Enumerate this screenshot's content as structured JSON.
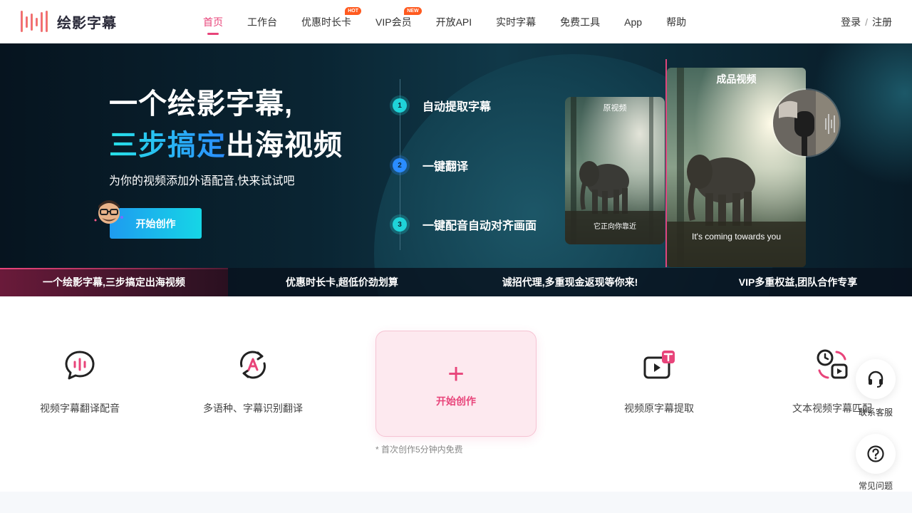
{
  "brand": {
    "name": "绘影字幕",
    "logo_icon": "waveform-logo-icon",
    "accent": "#e8447a"
  },
  "nav": {
    "items": [
      {
        "label": "首页",
        "active": true,
        "badge": ""
      },
      {
        "label": "工作台",
        "active": false,
        "badge": ""
      },
      {
        "label": "优惠时长卡",
        "active": false,
        "badge": "HOT"
      },
      {
        "label": "VIP会员",
        "active": false,
        "badge": "NEW"
      },
      {
        "label": "开放API",
        "active": false,
        "badge": ""
      },
      {
        "label": "实时字幕",
        "active": false,
        "badge": ""
      },
      {
        "label": "免费工具",
        "active": false,
        "badge": ""
      },
      {
        "label": "App",
        "active": false,
        "badge": ""
      },
      {
        "label": "帮助",
        "active": false,
        "badge": ""
      }
    ],
    "login": "登录",
    "separator": "/",
    "register": "注册"
  },
  "hero": {
    "title_line1": "一个绘影字幕,",
    "title_line2_highlight": "三步搞定",
    "title_line2_rest": "出海视频",
    "subtitle": "为你的视频添加外语配音,快来试试吧",
    "cta": "开始创作",
    "steps": [
      {
        "num": "1",
        "label": "自动提取字幕",
        "color": "#1fd3d8"
      },
      {
        "num": "2",
        "label": "一键翻译",
        "color": "#2a8cff"
      },
      {
        "num": "3",
        "label": "一键配音自动对齐画面",
        "color": "#1fd3d8"
      }
    ],
    "original_card": {
      "title": "原视频",
      "caption": "它正向你靠近"
    },
    "final_card": {
      "title": "成品视频",
      "caption": "It's coming towards you"
    }
  },
  "promo_strip": [
    {
      "label": "一个绘影字幕,三步搞定出海视频",
      "active": true
    },
    {
      "label": "优惠时长卡,超低价劲划算",
      "active": false
    },
    {
      "label": "诚招代理,多重现金返现等你来!",
      "active": false
    },
    {
      "label": "VIP多重权益,团队合作专享",
      "active": false
    }
  ],
  "features": {
    "items": [
      {
        "label": "视频字幕翻译配音",
        "icon": "speech-bubble-icon"
      },
      {
        "label": "多语种、字幕识别翻译",
        "icon": "translate-cycle-icon"
      },
      {
        "label": "视频原字幕提取",
        "icon": "video-text-extract-icon"
      },
      {
        "label": "文本视频字幕匹配",
        "icon": "clock-video-sync-icon"
      }
    ],
    "create": {
      "plus": "+",
      "label": "开始创作",
      "note": "* 首次创作5分钟内免费"
    }
  },
  "floating": {
    "support_label": "联系客服",
    "faq_label": "常见问题"
  }
}
